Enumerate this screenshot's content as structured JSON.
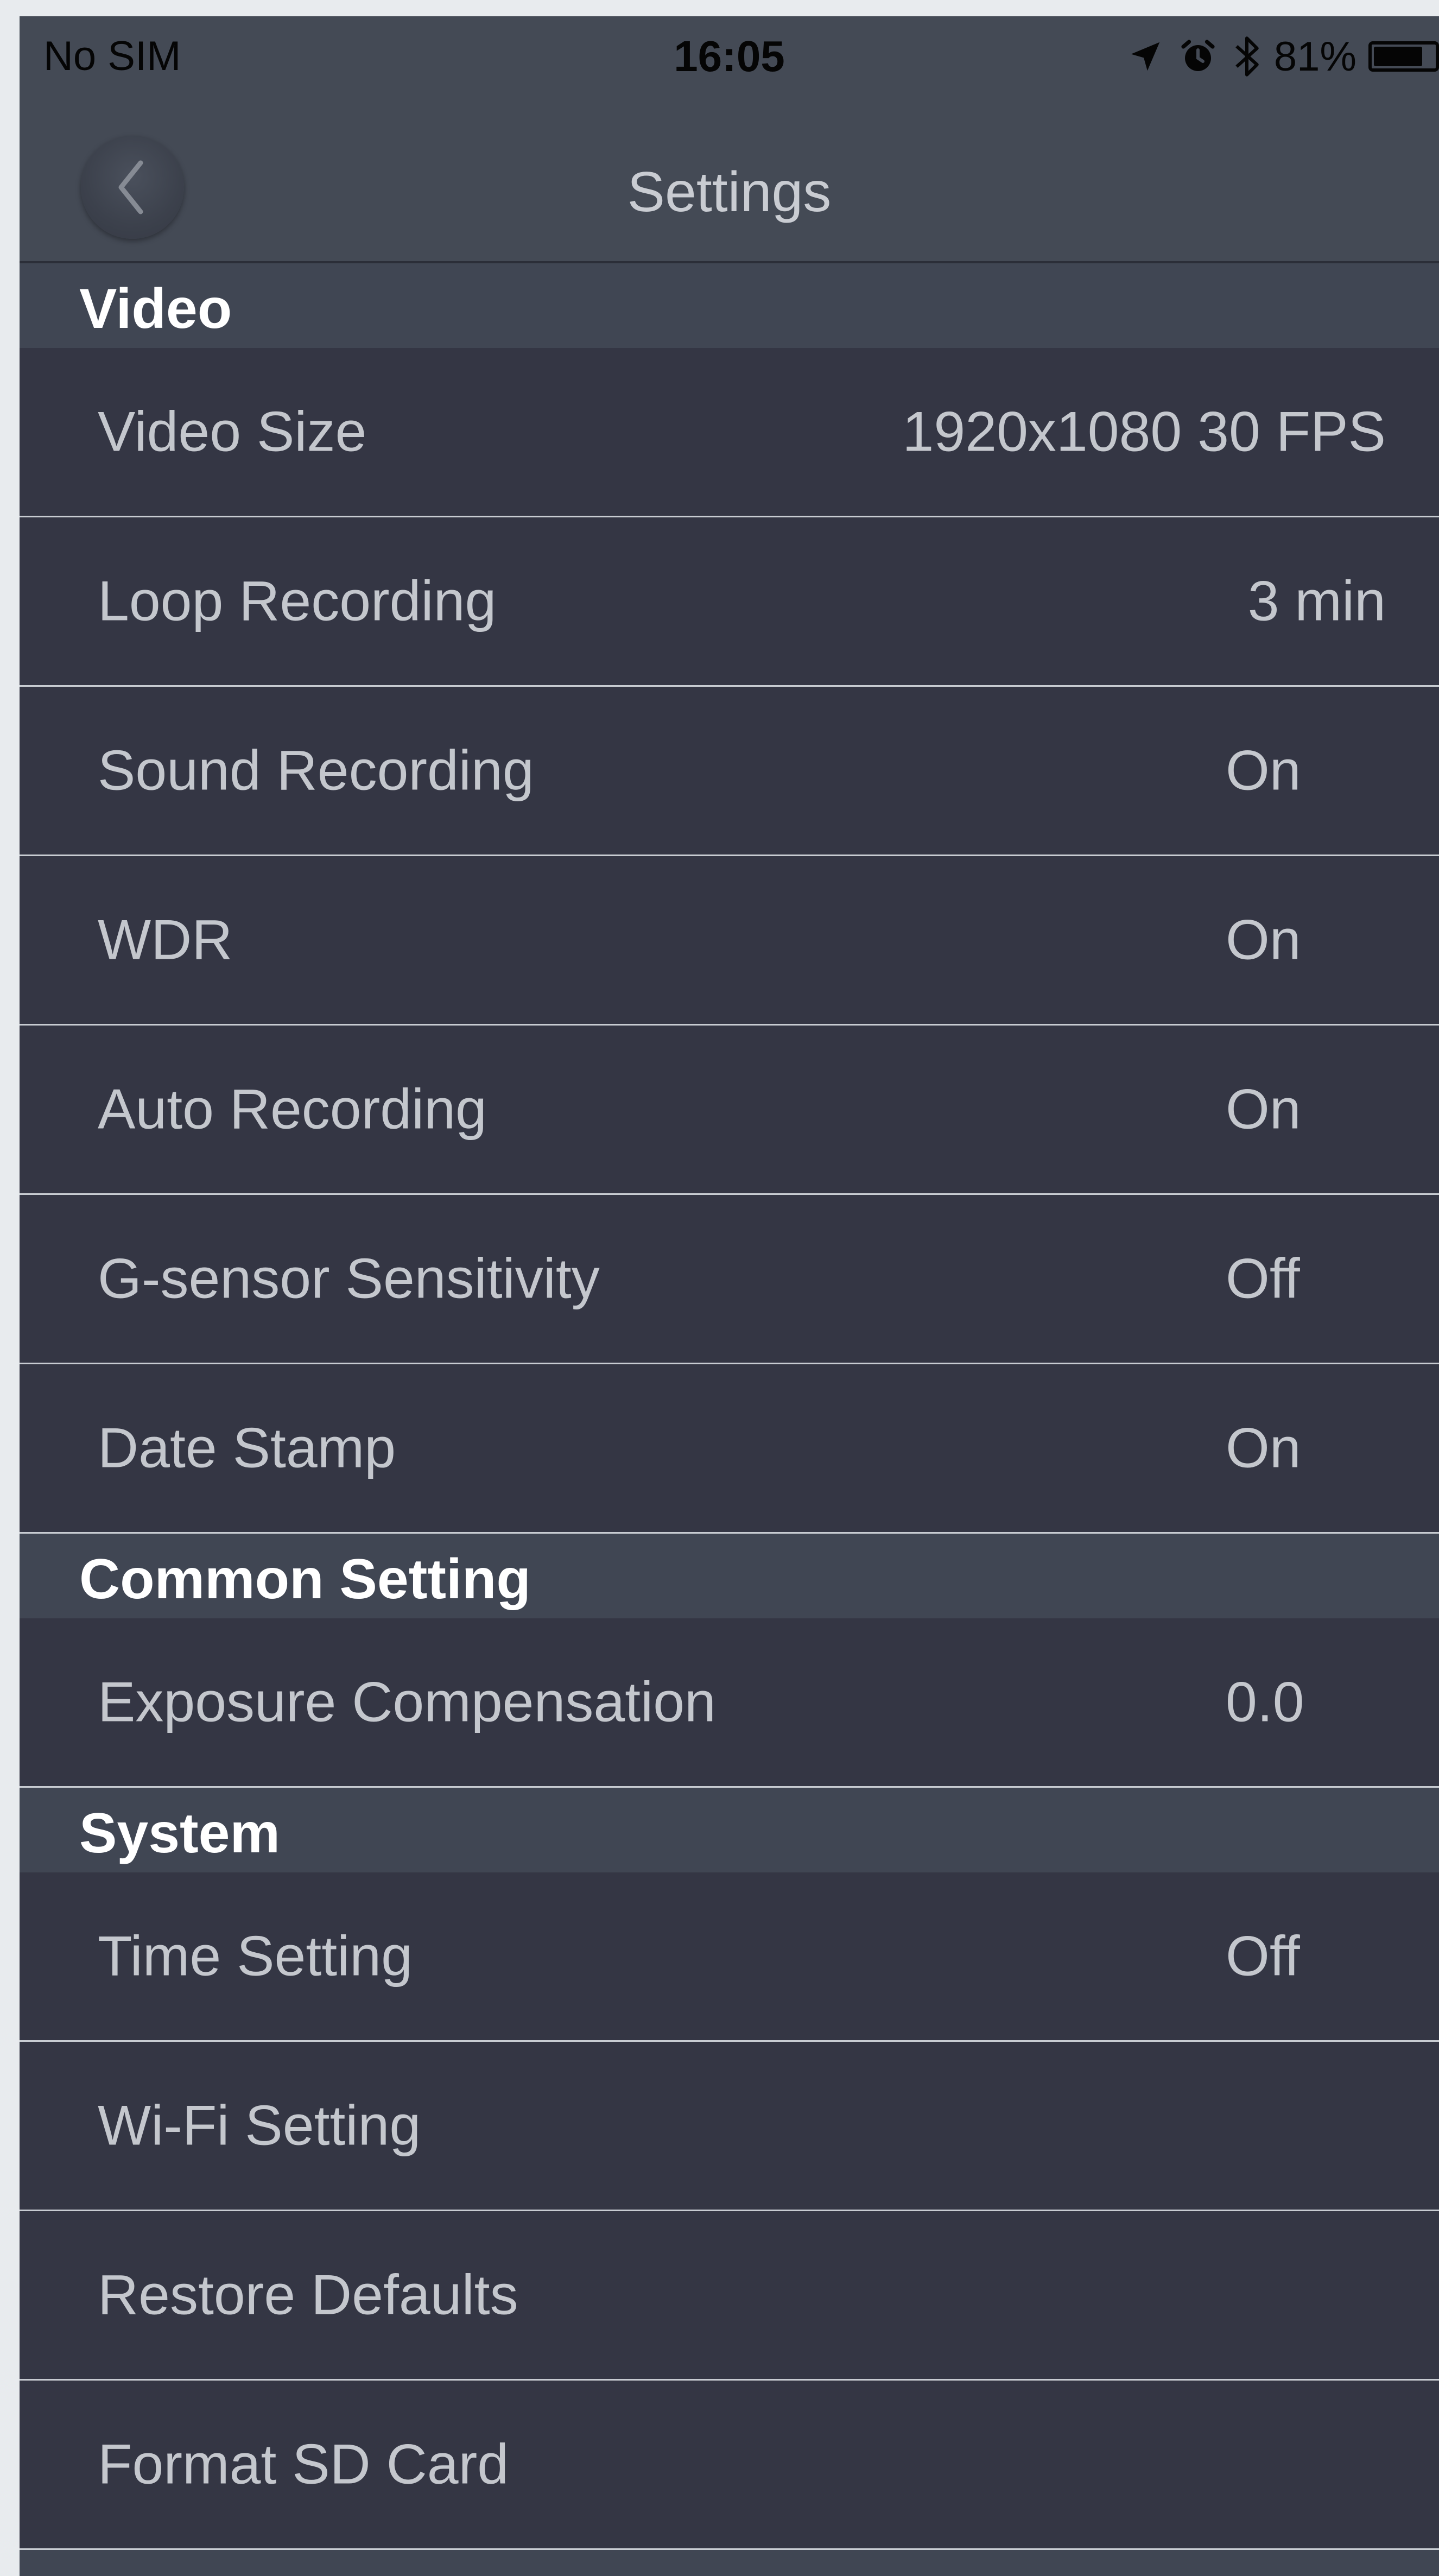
{
  "status_bar": {
    "carrier": "No SIM",
    "time": "16:05",
    "battery_percent": "81%",
    "battery_level": 0.81,
    "icons": [
      "location-arrow-icon",
      "alarm-icon",
      "bluetooth-icon",
      "battery-icon"
    ]
  },
  "nav": {
    "title": "Settings",
    "back_icon": "chevron-left-icon"
  },
  "sections": {
    "video": {
      "title": "Video",
      "rows": [
        {
          "label": "Video Size",
          "value": "1920x1080 30 FPS"
        },
        {
          "label": "Loop Recording",
          "value": "3 min"
        },
        {
          "label": "Sound Recording",
          "value": "On"
        },
        {
          "label": "WDR",
          "value": "On"
        },
        {
          "label": "Auto Recording",
          "value": "On"
        },
        {
          "label": "G-sensor Sensitivity",
          "value": "Off"
        },
        {
          "label": "Date Stamp",
          "value": "On"
        }
      ]
    },
    "common": {
      "title": "Common Setting",
      "rows": [
        {
          "label": "Exposure Compensation",
          "value": "0.0"
        }
      ]
    },
    "system": {
      "title": "System",
      "rows": [
        {
          "label": "Time Setting",
          "value": "Off"
        },
        {
          "label": "Wi-Fi Setting",
          "value": ""
        },
        {
          "label": "Restore Defaults",
          "value": ""
        },
        {
          "label": "Format SD Card",
          "value": ""
        }
      ]
    }
  },
  "colors": {
    "bar_background": "#444a55",
    "section_background": "#404653",
    "row_background": "#343644",
    "separator": "#c8ccd2",
    "row_text": "#c4c7cd",
    "header_text": "#ffffff"
  }
}
